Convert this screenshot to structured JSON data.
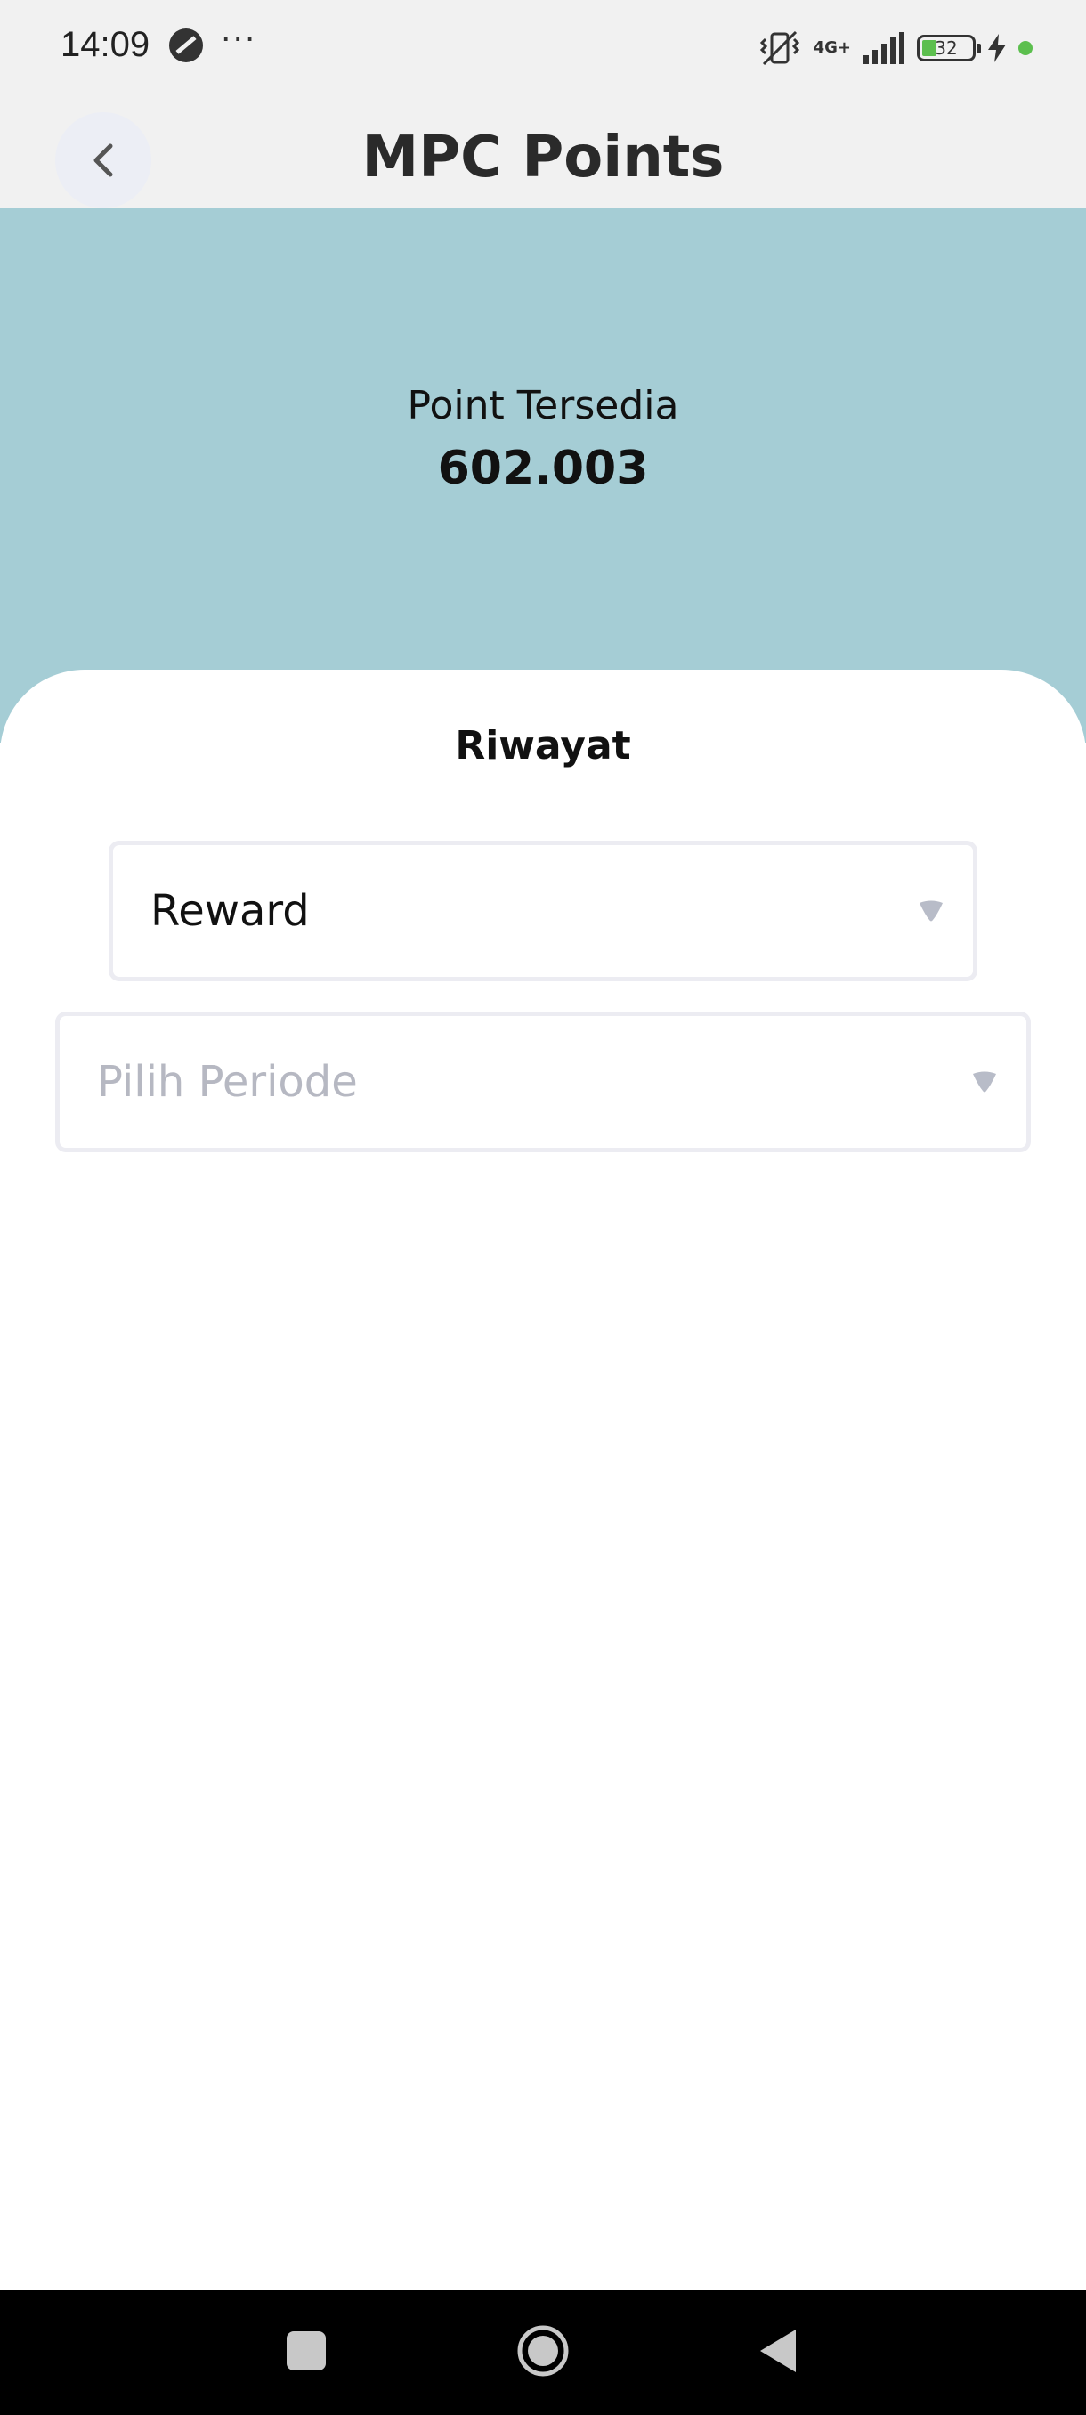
{
  "status_bar": {
    "time": "14:09",
    "network": "4G+",
    "battery": "32"
  },
  "header": {
    "title": "MPC Points",
    "back_icon": "chevron-left-icon"
  },
  "points": {
    "label": "Point Tersedia",
    "value": "602.003"
  },
  "tabs": [
    {
      "label": "Riwayat",
      "active": true
    }
  ],
  "filters": {
    "type": {
      "value": "Reward",
      "icon": "caret-down-icon"
    },
    "period": {
      "placeholder": "Pilih Periode",
      "icon": "caret-down-icon"
    }
  },
  "colors": {
    "hero_bg": "#a5cdd5",
    "caret": "#b8bcc8",
    "tab_underline": "#9a9a9a"
  }
}
